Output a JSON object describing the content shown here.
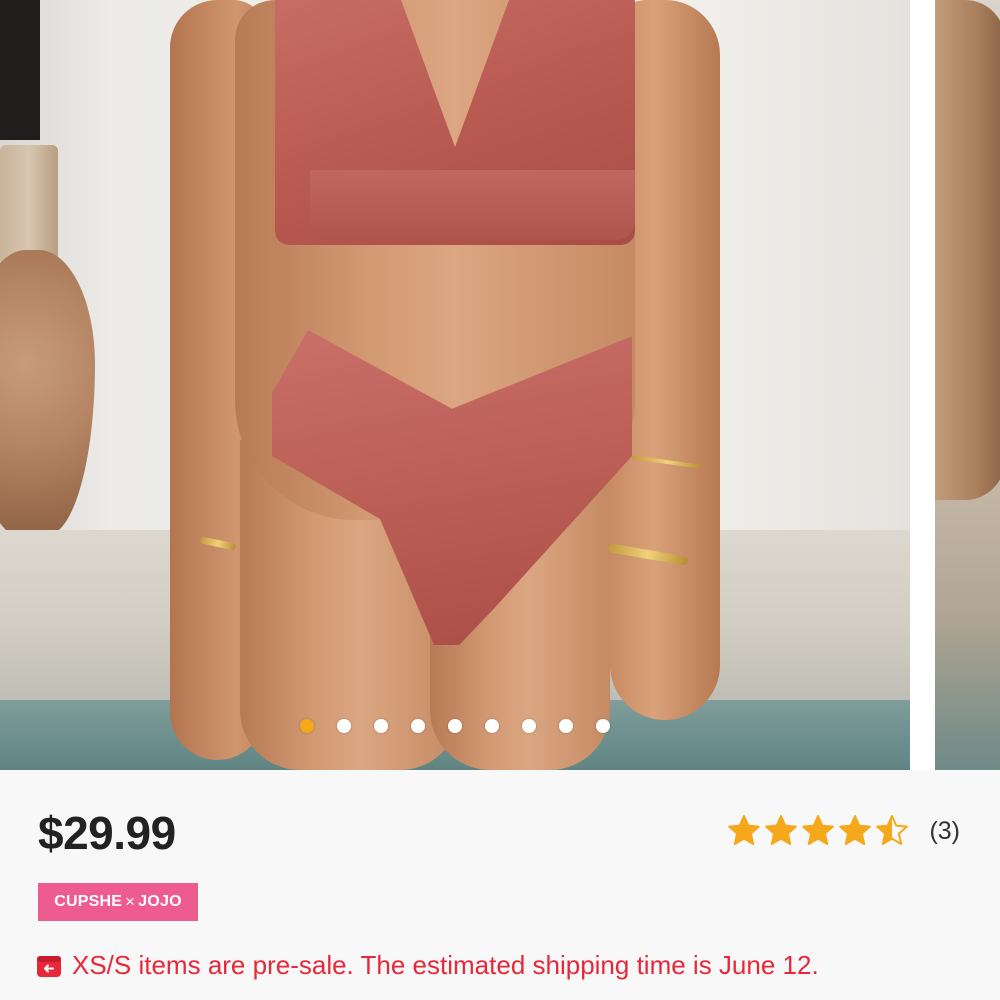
{
  "gallery": {
    "image_count": 9,
    "active_index": 0
  },
  "product": {
    "price": "$29.99",
    "rating": {
      "value": 4.5,
      "max": 5,
      "review_count": "(3)",
      "star_color": "#f5a81c"
    },
    "badge": {
      "brand_left": "CUPSHE",
      "separator": "×",
      "brand_right": "JOJO",
      "color": "#ee5b8f"
    },
    "notice": {
      "icon": "return-box-icon",
      "text": "XS/S items are pre-sale. The estimated shipping time is June 12.",
      "color": "#e8283a"
    }
  }
}
